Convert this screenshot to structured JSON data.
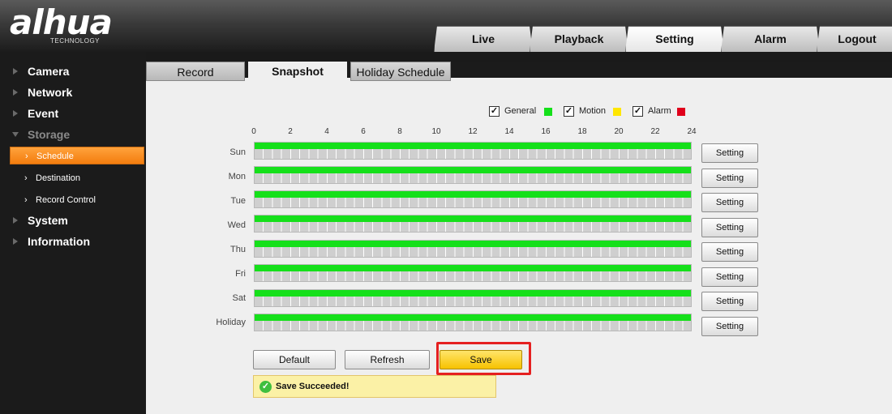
{
  "header": {
    "logo": "alhua",
    "logo_sub": "TECHNOLOGY",
    "nav": [
      "Live",
      "Playback",
      "Setting",
      "Alarm",
      "Logout"
    ],
    "active_nav": "Setting"
  },
  "sidebar": {
    "items": [
      "Camera",
      "Network",
      "Event",
      "Storage",
      "System",
      "Information"
    ],
    "storage_children": [
      "Schedule",
      "Destination",
      "Record Control"
    ],
    "active_child": "Schedule",
    "active_color": "#f7891a"
  },
  "subtabs": [
    "Record",
    "Snapshot",
    "Holiday Schedule"
  ],
  "active_subtab": "Snapshot",
  "legend": [
    {
      "label": "General",
      "checked": true,
      "color": "#15e01a"
    },
    {
      "label": "Motion",
      "checked": true,
      "color": "#ffe600"
    },
    {
      "label": "Alarm",
      "checked": true,
      "color": "#e0001b"
    }
  ],
  "hours": [
    "0",
    "2",
    "4",
    "6",
    "8",
    "10",
    "12",
    "14",
    "16",
    "18",
    "20",
    "22",
    "24"
  ],
  "days": [
    "Sun",
    "Mon",
    "Tue",
    "Wed",
    "Thu",
    "Fri",
    "Sat",
    "Holiday"
  ],
  "setting_label": "Setting",
  "buttons": {
    "default": "Default",
    "refresh": "Refresh",
    "save": "Save"
  },
  "status": {
    "text": "Save Succeeded!",
    "icon": "check-circle-icon"
  }
}
